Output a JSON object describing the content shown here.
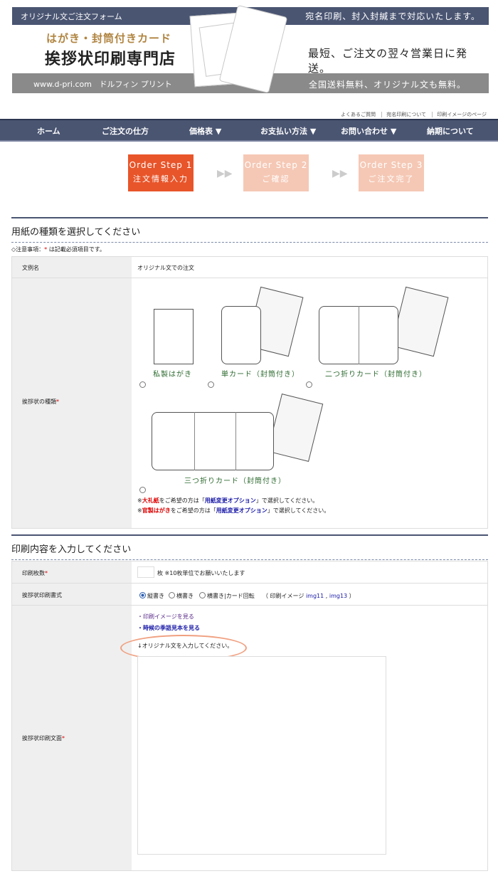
{
  "header": {
    "bar_left": "オリジナル文ご注文フォーム",
    "bar_right": "宛名印刷、封入封緘まで対応いたします。",
    "subtitle": "はがき・封筒付きカード",
    "title": "挨拶状印刷専門店",
    "right_text": "最短、ご注文の翌々営業日に発送。",
    "url": "www.d-pri.com",
    "brand": "ドルフィン プリント",
    "bottom_right": "全国送料無料、オリジナル文も無料。"
  },
  "top_links": [
    "よくあるご質問",
    "宛名印刷について",
    "印刷イメージのページ"
  ],
  "nav": [
    {
      "label": "ホーム"
    },
    {
      "label": "ご注文の仕方"
    },
    {
      "label": "価格表 ▼"
    },
    {
      "label": "お支払い方法 ▼"
    },
    {
      "label": "お問い合わせ ▼"
    },
    {
      "label": "納期について"
    }
  ],
  "steps": [
    {
      "title": "Order Step 1",
      "label": "注文情報入力",
      "active": true
    },
    {
      "title": "Order Step 2",
      "label": "ご確認",
      "active": false
    },
    {
      "title": "Order Step 3",
      "label": "ご注文完了",
      "active": false
    }
  ],
  "section1": {
    "title": "用紙の種類を選択してください",
    "note_prefix": "◇注意事項：",
    "note_star": "*",
    "note_suffix": " は記載必須項目です。",
    "row1_label": "文例名",
    "row1_value": "オリジナル文での注文",
    "row2_label": "挨拶状の種類",
    "paper_options": [
      "私製はがき",
      "単カード（封筒付き）",
      "二つ折りカード（封筒付き）",
      "三つ折りカード（封筒付き）"
    ],
    "notice1_prefix": "※",
    "notice1_em": "大礼紙",
    "notice1_mid": "をご希望の方は「",
    "notice1_link": "用紙変更オプション",
    "notice1_suffix": "」で選択してください。",
    "notice2_prefix": "※",
    "notice2_em": "官製はがき",
    "notice2_mid": "をご希望の方は「",
    "notice2_link": "用紙変更オプション",
    "notice2_suffix": "」で選択してください。"
  },
  "section2": {
    "title": "印刷内容を入力してください",
    "qty_label": "印刷枚数",
    "qty_value": "",
    "qty_unit": "枚 ※10枚単位でお願いいたします",
    "format_label": "挨拶状印刷書式",
    "format_options": [
      "縦書き",
      "横書き",
      "横書き|カード回転"
    ],
    "format_selected": "縦書き",
    "image_prefix": "（ 印刷イメージ",
    "image_link1": "img11",
    "image_sep": ",",
    "image_link2": "img13",
    "image_suffix": " ）",
    "text_label": "挨拶状印刷文面",
    "link1": "・印刷イメージを見る",
    "link2": "・時候の季語見本を見る",
    "instruction": "↓オリジナル文を入力してください。",
    "textarea_value": ""
  },
  "colors": {
    "nav": "#4a5572",
    "step_active": "#e8552a",
    "step_inactive": "#f5c8b5",
    "highlight": "#f0a080"
  }
}
